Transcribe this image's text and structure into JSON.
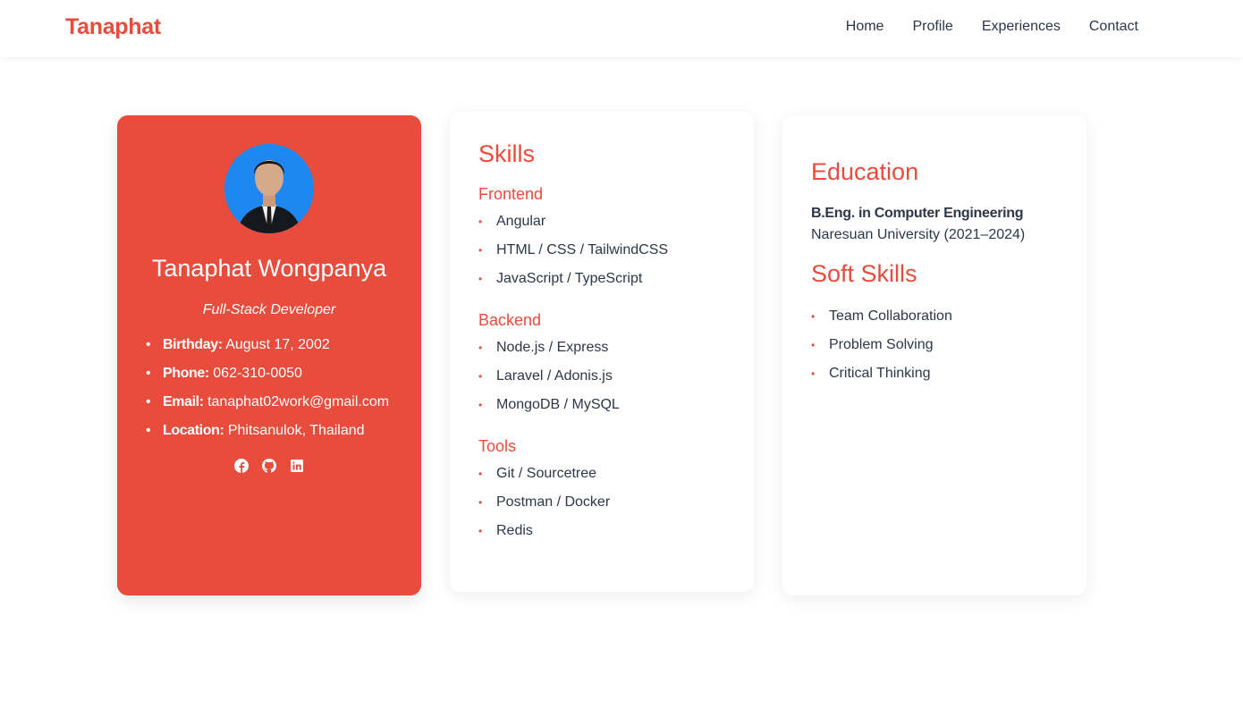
{
  "brand": "Tanaphat",
  "nav": {
    "home": "Home",
    "profile": "Profile",
    "experiences": "Experiences",
    "contact": "Contact"
  },
  "profile": {
    "name": "Tanaphat Wongpanya",
    "role": "Full-Stack Developer",
    "info": [
      {
        "label": "Birthday:",
        "value": "August 17, 2002"
      },
      {
        "label": "Phone:",
        "value": "062-310-0050"
      },
      {
        "label": "Email:",
        "value": "tanaphat02work@gmail.com"
      },
      {
        "label": "Location:",
        "value": "Phitsanulok, Thailand"
      }
    ],
    "socials": [
      "facebook-icon",
      "github-icon",
      "linkedin-icon"
    ]
  },
  "skills": {
    "title": "Skills",
    "groups": [
      {
        "title": "Frontend",
        "items": [
          "Angular",
          "HTML / CSS / TailwindCSS",
          "JavaScript / TypeScript"
        ]
      },
      {
        "title": "Backend",
        "items": [
          "Node.js / Express",
          "Laravel / Adonis.js",
          "MongoDB / MySQL"
        ]
      },
      {
        "title": "Tools",
        "items": [
          "Git / Sourcetree",
          "Postman / Docker",
          "Redis"
        ]
      }
    ]
  },
  "education": {
    "title": "Education",
    "degree": "B.Eng. in Computer Engineering",
    "school": "Naresuan University (2021–2024)"
  },
  "soft_skills": {
    "title": "Soft Skills",
    "items": [
      "Team Collaboration",
      "Problem Solving",
      "Critical Thinking"
    ]
  },
  "colors": {
    "accent": "#e74c3c",
    "text": "#2d3748",
    "avatar_bg": "#1e88f0"
  }
}
